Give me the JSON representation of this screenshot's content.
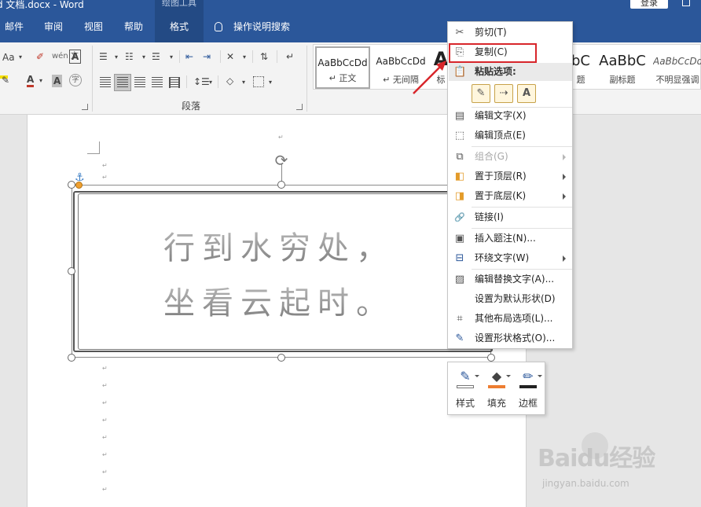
{
  "titlebar": {
    "title": "d 文档.docx  -  Word",
    "context_group": "绘图工具",
    "login_label": "登录"
  },
  "tabs": [
    {
      "label": "邮件"
    },
    {
      "label": "审阅"
    },
    {
      "label": "视图"
    },
    {
      "label": "帮助"
    },
    {
      "label": "格式",
      "active": true
    }
  ],
  "tell_me": {
    "label": "操作说明搜索"
  },
  "ribbon": {
    "font": {
      "font_size_label": "Aa",
      "phonetic_label": "wén 文",
      "border_label": "A",
      "color_label": "A",
      "shading_label": "A",
      "enclose_label": "字"
    },
    "paragraph": {
      "label": "段落"
    },
    "styles": [
      {
        "preview": "AaBbCcDd",
        "name": "↵ 正文",
        "selected": true
      },
      {
        "preview": "AaBbCcDd",
        "name": "↵ 无间隔"
      },
      {
        "preview": "A",
        "name": "标"
      },
      {
        "preview": "bC",
        "name": "题"
      },
      {
        "preview": "AaBbC",
        "name": "副标题"
      },
      {
        "preview": "AaBbCcDd",
        "name": "不明显强调"
      }
    ]
  },
  "document": {
    "poem_lines": [
      "行到水穷处，",
      "坐看云起时。"
    ],
    "paragraph_mark": "↵"
  },
  "context_menu": {
    "items": [
      {
        "label": "剪切(T)",
        "icon": "scissors-icon",
        "glyph": "✂"
      },
      {
        "label": "复制(C)",
        "icon": "copy-icon",
        "glyph": "⎘",
        "highlighted": true
      },
      {
        "label": "编辑文字(X)",
        "icon": "edit-text-icon",
        "glyph": "▤"
      },
      {
        "label": "编辑顶点(E)",
        "icon": "edit-points-icon",
        "glyph": "⬚"
      },
      {
        "label": "组合(G)",
        "icon": "group-icon",
        "glyph": "⧉",
        "disabled": true,
        "submenu": true
      },
      {
        "label": "置于顶层(R)",
        "icon": "bring-front-icon",
        "glyph": "◧",
        "submenu": true
      },
      {
        "label": "置于底层(K)",
        "icon": "send-back-icon",
        "glyph": "◨",
        "submenu": true
      },
      {
        "label": "链接(I)",
        "icon": "link-icon",
        "glyph": "🔗"
      },
      {
        "label": "插入题注(N)...",
        "icon": "caption-icon",
        "glyph": "▣"
      },
      {
        "label": "环绕文字(W)",
        "icon": "wrap-text-icon",
        "glyph": "⊟",
        "submenu": true
      },
      {
        "label": "编辑替换文字(A)...",
        "icon": "alt-text-icon",
        "glyph": "▨"
      },
      {
        "label": "设置为默认形状(D)",
        "icon": "",
        "glyph": ""
      },
      {
        "label": "其他布局选项(L)...",
        "icon": "layout-options-icon",
        "glyph": "⌗"
      },
      {
        "label": "设置形状格式(O)...",
        "icon": "format-shape-icon",
        "glyph": "✎"
      }
    ],
    "paste_header": "粘贴选项:",
    "paste_options": [
      {
        "icon": "paste-keep-source-icon",
        "glyph": "✎"
      },
      {
        "icon": "paste-picture-icon",
        "glyph": "⇢"
      },
      {
        "icon": "paste-text-only-icon",
        "glyph": "A"
      }
    ]
  },
  "mini_toolbar": {
    "buttons": [
      {
        "label": "样式",
        "icon": "style-icon",
        "glyph": "✎",
        "bar_color": "#ffffff"
      },
      {
        "label": "填充",
        "icon": "fill-icon",
        "glyph": "◆",
        "bar_color": "#ed7d31"
      },
      {
        "label": "边框",
        "icon": "outline-icon",
        "glyph": "✏",
        "bar_color": "#222222"
      }
    ]
  },
  "watermark": {
    "logo_text": "Baidu经验",
    "sub_text": "jingyan.baidu.com"
  },
  "colors": {
    "accent": "#2b579a",
    "highlight_box": "#d8262b",
    "fill_orange": "#ed7d31"
  }
}
